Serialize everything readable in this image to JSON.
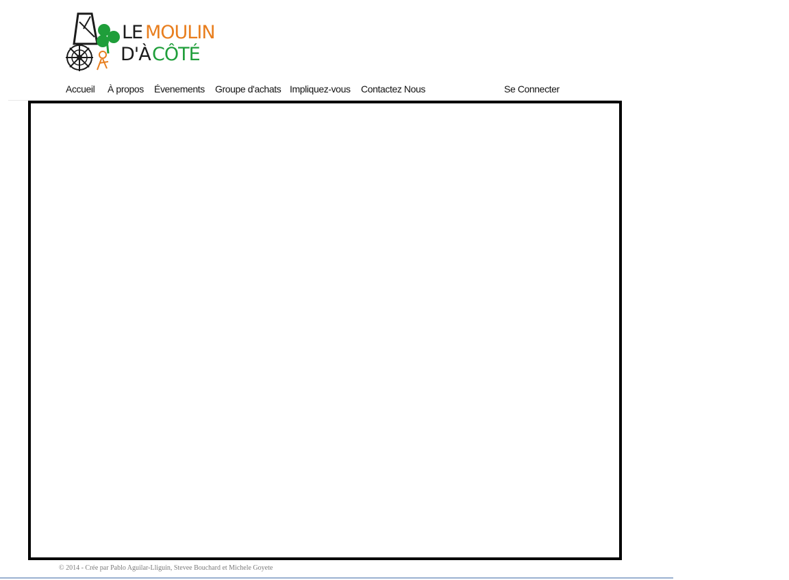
{
  "brand": {
    "logo_text": [
      "LE",
      "MOULIN",
      "D'À",
      "CÔTÉ"
    ],
    "colors": {
      "dark": "#1b1b1b",
      "orange": "#e87e1e",
      "green": "#1f9e3a"
    }
  },
  "nav": {
    "items": [
      {
        "label": "Accueil"
      },
      {
        "label": "À propos"
      },
      {
        "label": "Évenements"
      },
      {
        "label": "Groupe d'achats"
      },
      {
        "label": "Impliquez-vous"
      },
      {
        "label": "Contactez Nous"
      }
    ],
    "login_label": "Se Connecter"
  },
  "footer": {
    "text": "© 2014 - Crée par Pablo Aguilar-Lliguin, Stevee Bouchard et Michele Goyete"
  }
}
